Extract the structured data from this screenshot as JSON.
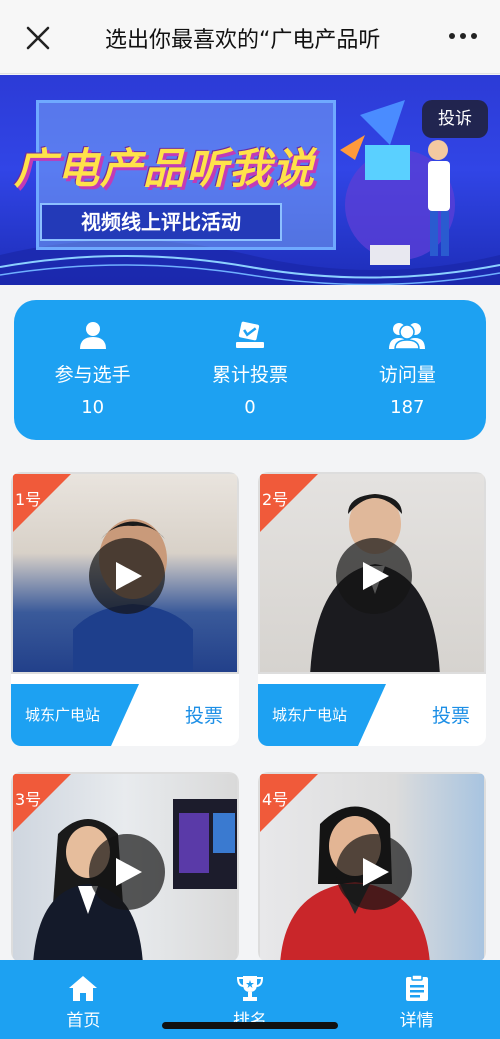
{
  "nav": {
    "title": "选出你最喜欢的“广电产品听"
  },
  "banner": {
    "headline": "广电产品听我说",
    "subtitle": "视频线上评比活动",
    "report_label": "投诉"
  },
  "stats": [
    {
      "icon": "person-icon",
      "label": "参与选手",
      "value": "10"
    },
    {
      "icon": "ballot-icon",
      "label": "累计投票",
      "value": "0"
    },
    {
      "icon": "group-icon",
      "label": "访问量",
      "value": "187"
    }
  ],
  "contestants": [
    {
      "number": "1号",
      "station": "城东广电站",
      "vote_label": "投票"
    },
    {
      "number": "2号",
      "station": "城东广电站",
      "vote_label": "投票"
    },
    {
      "number": "3号"
    },
    {
      "number": "4号"
    }
  ],
  "tabs": [
    {
      "icon": "home-icon",
      "label": "首页"
    },
    {
      "icon": "trophy-icon",
      "label": "排名"
    },
    {
      "icon": "clipboard-icon",
      "label": "详情"
    }
  ],
  "colors": {
    "accent": "#1da1f2",
    "tag": "#f05a3a",
    "vote_text": "#1d8fe6"
  }
}
